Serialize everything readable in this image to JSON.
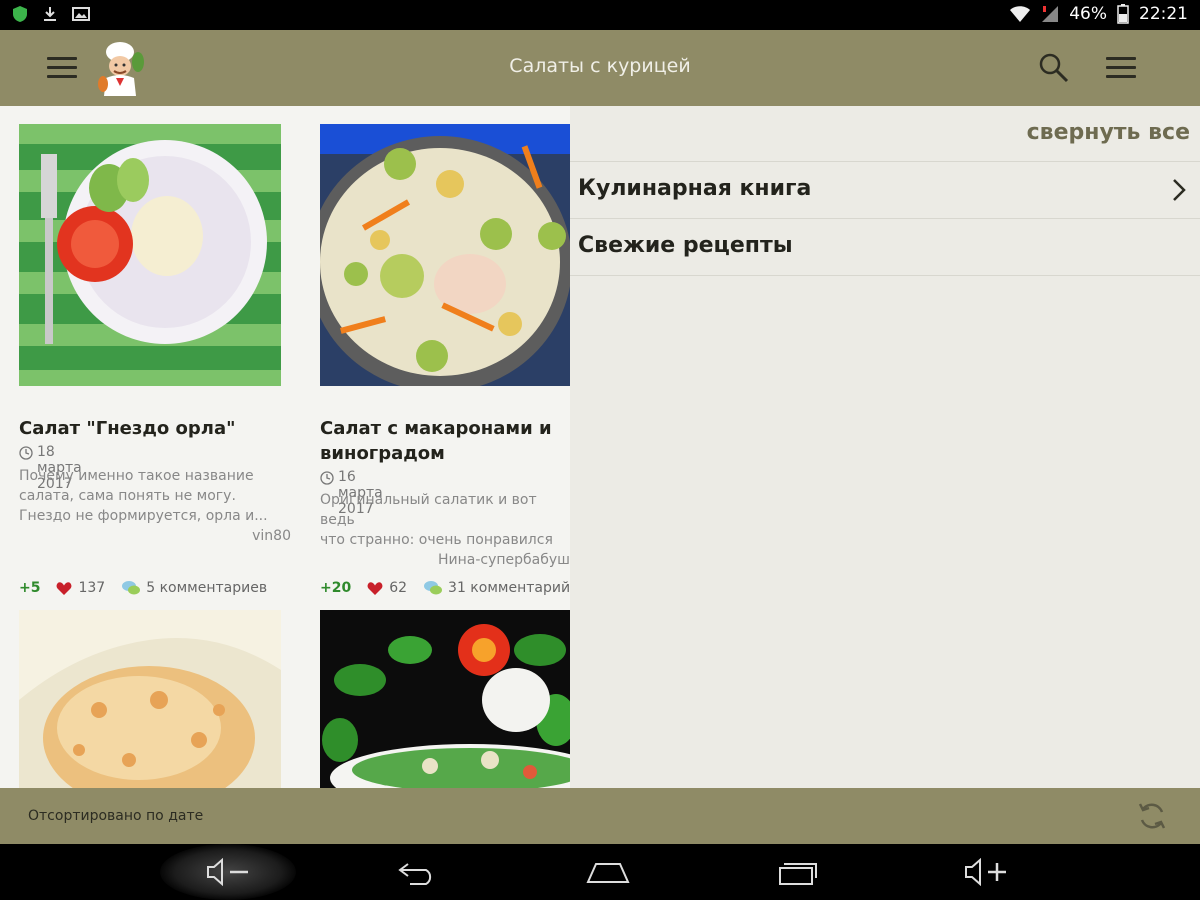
{
  "status_bar": {
    "battery": "46%",
    "time": "22:21"
  },
  "toolbar": {
    "title": "Салаты с курицей"
  },
  "recipes": [
    {
      "title": "Салат \"Гнездо орла\"",
      "date": "18 марта 2017",
      "description": "Почему именно такое название\nсалата, сама понять не могу.\nГнездо не формируется, орла и...",
      "author": "vin80",
      "score": "+5",
      "likes": "137",
      "comments": "5 комментариев"
    },
    {
      "title": "Салат с макаронами и\nвиноградом",
      "date": "16 марта 2017",
      "description": "Оригинальный салатик и вот ведь\nчто странно: очень понравился\nмужу. Вот уж не ожидала. Рецепт",
      "author": "Нина-супербабушка",
      "score": "+20",
      "likes": "62",
      "comments": "31 комментарий"
    }
  ],
  "side_menu": {
    "collapse_all": "свернуть все",
    "items": [
      {
        "label": "Кулинарная книга"
      },
      {
        "label": "Свежие рецепты"
      }
    ]
  },
  "bottom_bar": {
    "sort_label": "Отсортировано по дате"
  },
  "colors": {
    "toolbar": "#8f8b66",
    "accent_text": "#6e6b50",
    "score_green": "#2f8a2c"
  }
}
